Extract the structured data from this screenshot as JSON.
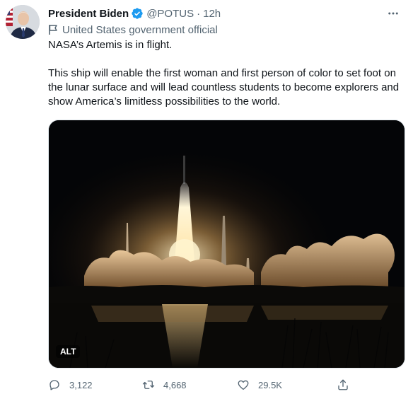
{
  "author": {
    "name": "President Biden",
    "handle": "@POTUS",
    "separator": "·",
    "time": "12h",
    "label": "United States government official"
  },
  "tweet": {
    "line1": "NASA’s Artemis is in flight.",
    "line2": "This ship will enable the first woman and first person of color to set foot on the lunar surface and will lead countless students to become explorers and show America’s limitless possibilities to the world."
  },
  "media": {
    "alt_badge": "ALT",
    "description_icon": "rocket-launch-photo"
  },
  "actions": {
    "replies": "3,122",
    "retweets": "4,668",
    "likes": "29.5K"
  },
  "colors": {
    "verified": "#1d9bf0",
    "secondary_text": "#536471",
    "primary_text": "#0f1419"
  }
}
